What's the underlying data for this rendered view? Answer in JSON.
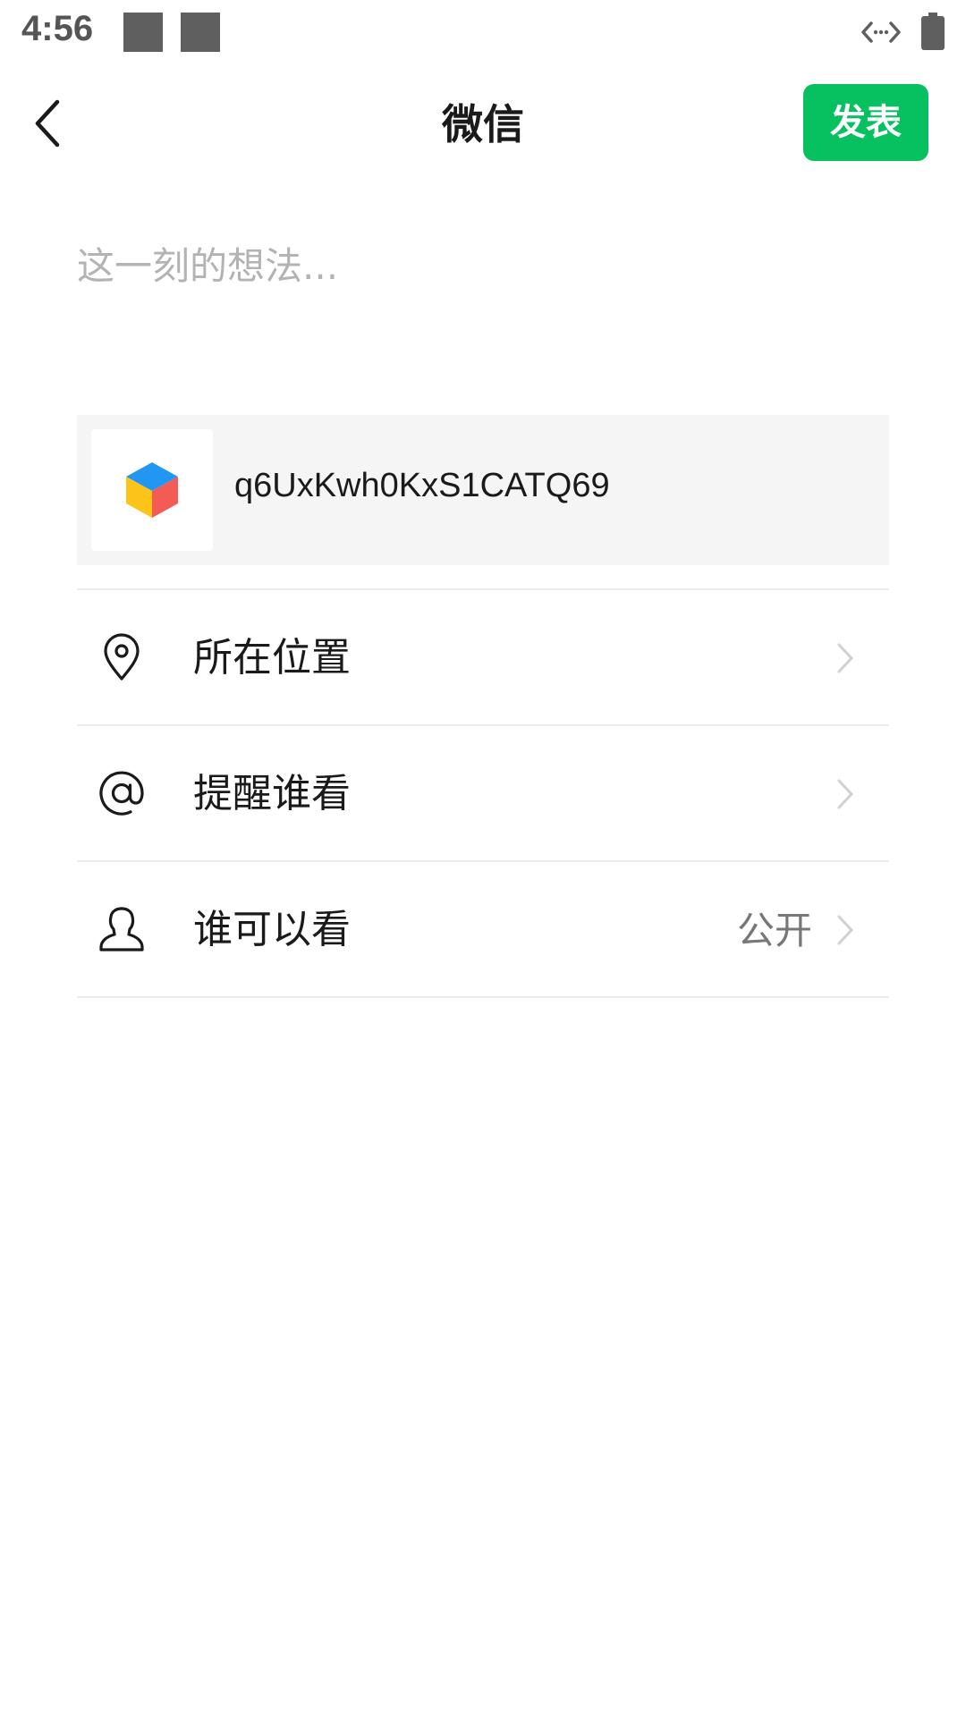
{
  "status_bar": {
    "time": "4:56"
  },
  "header": {
    "title": "微信",
    "publish_label": "发表"
  },
  "composer": {
    "placeholder": "这一刻的想法...",
    "value": ""
  },
  "shared_item": {
    "title": "q6UxKwh0KxS1CATQ69",
    "thumbnail_icon": "colored-cube-icon"
  },
  "options": [
    {
      "label": "所在位置",
      "icon": "location-pin-icon",
      "value": ""
    },
    {
      "label": "提醒谁看",
      "icon": "at-sign-icon",
      "value": ""
    },
    {
      "label": "谁可以看",
      "icon": "person-icon",
      "value": "公开"
    }
  ],
  "colors": {
    "accent": "#07c160",
    "background": "#ffffff",
    "card": "#f5f5f5",
    "placeholder": "#b3b3b3"
  }
}
